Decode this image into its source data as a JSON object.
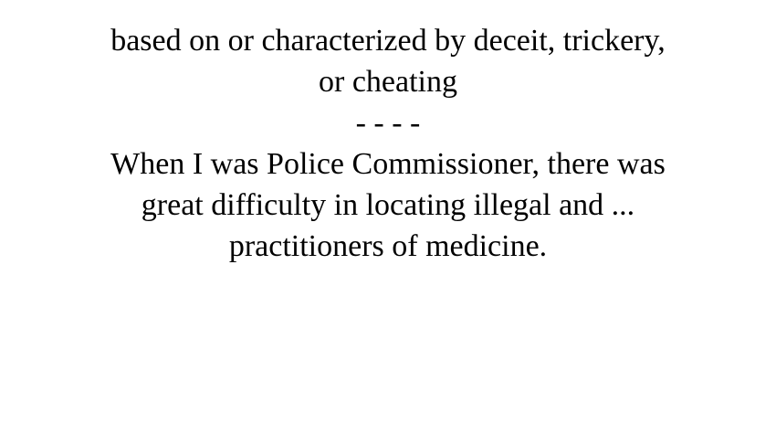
{
  "card": {
    "definition_lines": [
      "based on or characterized by deceit, trickery,",
      "or cheating"
    ],
    "separator": "- - - -",
    "example_lines": [
      "When I was Police Commissioner, there was",
      "great difficulty in locating illegal and ...",
      "practitioners of medicine."
    ]
  }
}
